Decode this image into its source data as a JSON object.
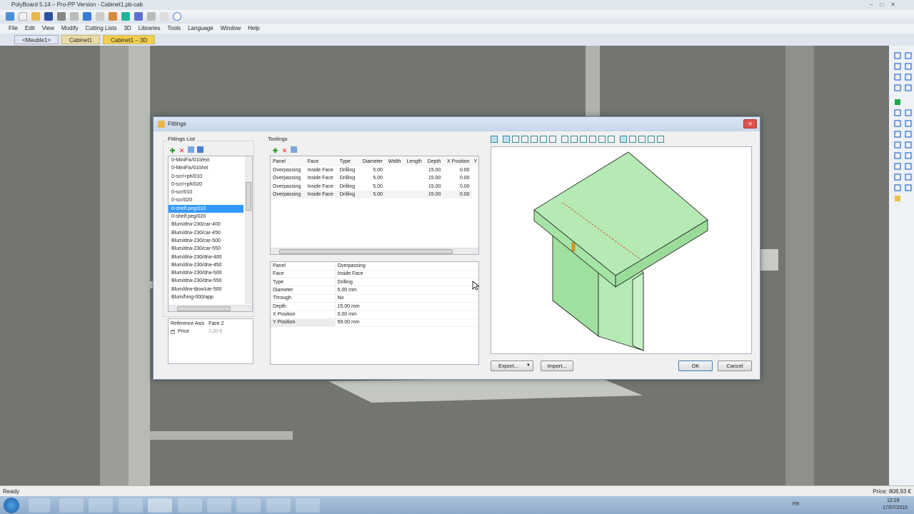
{
  "window": {
    "title": "PolyBoard 5.14 – Pro-PP Version - Cabinet1.pb-cab"
  },
  "menu": [
    "File",
    "Edit",
    "View",
    "Modify",
    "Cutting Lists",
    "3D",
    "Libraries",
    "Tools",
    "Language",
    "Window",
    "Help"
  ],
  "tabs": [
    "<Meuble1>",
    "Cabinet1",
    "Cabinet1 – 3D"
  ],
  "dialog": {
    "title": "Fittings",
    "fittings_label": "Fittings List",
    "fittings": [
      "0-MiniFix/010/ext",
      "0-MiniFix/010/int",
      "0-scr/+ph/010",
      "0-scr/+ph/020",
      "0-scr/010",
      "0-scr/020",
      "0-shelf.peg/010",
      "0-shelf.peg/020",
      "Blum/drw-230/car-400",
      "Blum/drw-230/car-450",
      "Blum/drw-230/car-500",
      "Blum/drw-230/car-550",
      "Blum/drw-230/drw-400",
      "Blum/drw-230/drw-450",
      "Blum/drw-230/drw-500",
      "Blum/drw-230/drw-550",
      "Blum/drw-tbox/car-500",
      "Blum/hing-000/app"
    ],
    "selected_fitting": "0-shelf.peg/010",
    "ref_axis_label": "Reference Axis",
    "ref_axis_value": "Face 2",
    "price_label": "Price",
    "price_value": "2,00 €",
    "toolings_label": "Toolings",
    "toolings_columns": [
      "Panel",
      "Face",
      "Type",
      "Diameter",
      "Width",
      "Length",
      "Depth",
      "X Position",
      "Y P"
    ],
    "toolings_rows": [
      [
        "Overpassing",
        "Inside Face",
        "Drilling",
        "5.00",
        "",
        "",
        "15.00",
        "0.00"
      ],
      [
        "Overpassing",
        "Inside Face",
        "Drilling",
        "5.00",
        "",
        "",
        "15.00",
        "0.00"
      ],
      [
        "Overpassing",
        "Inside Face",
        "Drilling",
        "5.00",
        "",
        "",
        "15.00",
        "0.00"
      ],
      [
        "Overpassing",
        "Inside Face",
        "Drilling",
        "5.00",
        "",
        "",
        "15.00",
        "0.00"
      ]
    ],
    "properties": [
      [
        "Panel",
        "Overpassing"
      ],
      [
        "Face",
        "Inside Face"
      ],
      [
        "Type",
        "Drilling"
      ],
      [
        "Diameter",
        "5.00 mm"
      ],
      [
        "Through",
        "No"
      ],
      [
        "Depth",
        "15.00 mm"
      ],
      [
        "X Position",
        "0.00 mm"
      ],
      [
        "Y Position",
        "59.00 mm"
      ]
    ],
    "export_label": "Export...",
    "import_label": "Import...",
    "ok_label": "OK",
    "cancel_label": "Cancel"
  },
  "status": {
    "left": "Ready",
    "right": "Price: 808,93 €"
  },
  "tray": {
    "lang": "FR",
    "time": "12:29",
    "date": "17/07/2015"
  },
  "colors": {
    "selection": "#3399ff",
    "panel_fill": "#a8e6a8",
    "accent": "#f3cf4e"
  }
}
